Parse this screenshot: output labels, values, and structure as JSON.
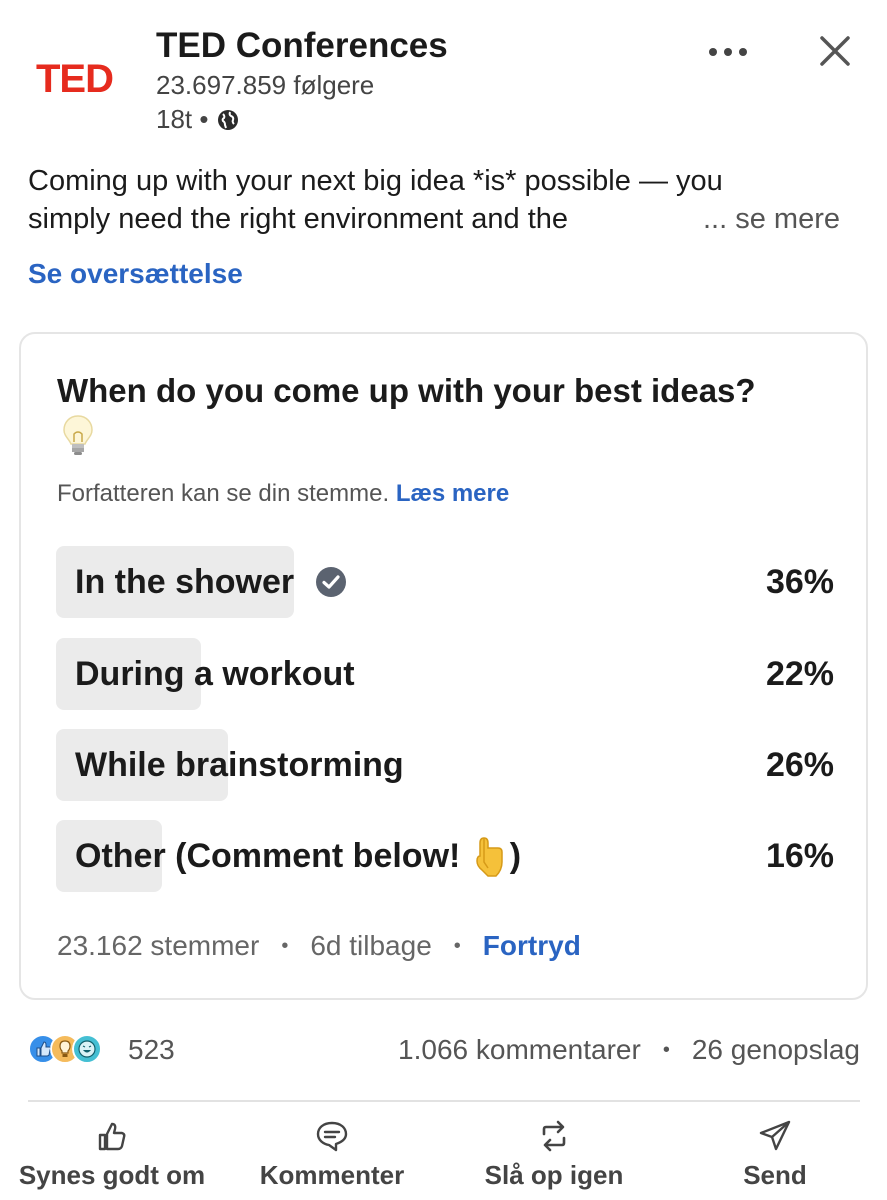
{
  "header": {
    "logo_text": "TED",
    "org_name": "TED Conferences",
    "followers": "23.697.859 følgere",
    "time": "18t •",
    "brand_color": "#e62b1e"
  },
  "post": {
    "line1": "Coming up with your next big idea *is* possible — you",
    "line2": "simply need the right environment and the",
    "see_more": "... se mere",
    "translate": "Se oversættelse"
  },
  "poll": {
    "question": "When do you come up with your best ideas?",
    "note": "Forfatteren kan se din stemme.",
    "note_link": "Læs mere",
    "options": [
      {
        "label": "In the shower",
        "percent": "36%",
        "fill": 0.36,
        "selected": true
      },
      {
        "label": "During a workout",
        "percent": "22%",
        "fill": 0.22,
        "selected": false
      },
      {
        "label": "While brainstorming",
        "percent": "26%",
        "fill": 0.26,
        "selected": false
      },
      {
        "label": "Other (Comment below! ",
        "label_end": ")",
        "percent": "16%",
        "fill": 0.16,
        "selected": false
      }
    ],
    "votes": "23.162 stemmer",
    "time_left": "6d tilbage",
    "undo": "Fortryd"
  },
  "social": {
    "reaction_count": "523",
    "comments": "1.066 kommentarer",
    "reposts": "26 genopslag"
  },
  "actions": {
    "like": "Synes godt om",
    "comment": "Kommenter",
    "repost": "Slå op igen",
    "send": "Send"
  },
  "icons": {
    "more": "more-horizontal-icon",
    "close": "close-icon",
    "globe": "globe-icon",
    "check": "check-circle-icon",
    "bulb": "light-bulb-emoji",
    "point": "pointing-down-emoji"
  },
  "colors": {
    "link": "#2a64c2",
    "poll_bar": "#ebebeb",
    "check": "#5b6370"
  }
}
